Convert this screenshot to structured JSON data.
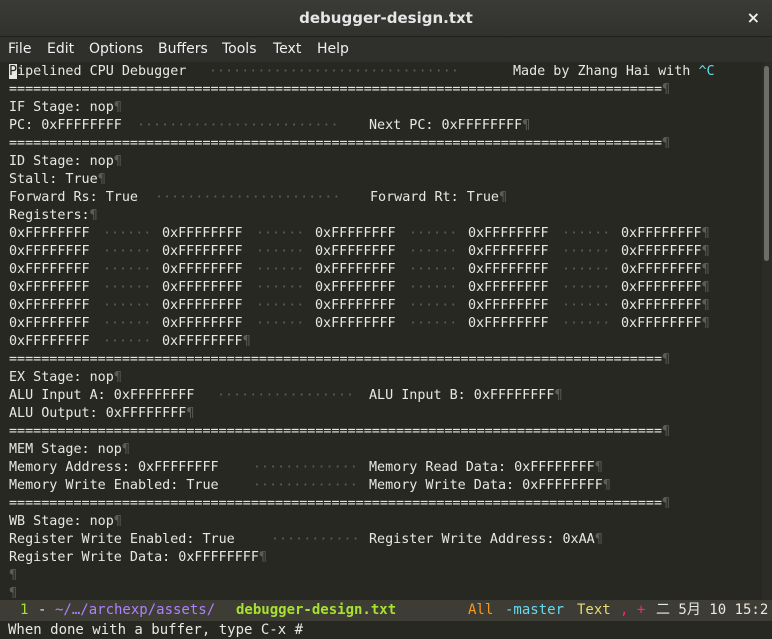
{
  "window": {
    "title": "debugger-design.txt",
    "close_glyph": "×"
  },
  "menu": [
    "File",
    "Edit",
    "Options",
    "Buffers",
    "Tools",
    "Text",
    "Help"
  ],
  "header": {
    "first_char": "P",
    "title_rest": "ipelined CPU Debugger",
    "credit": "Made by Zhang Hai with ",
    "credit_ctrl": "^C"
  },
  "separator": "=================================================================================",
  "if": {
    "stage": "IF Stage: nop",
    "pc": "PC: 0xFFFFFFFF",
    "next_pc": "Next PC: 0xFFFFFFFF"
  },
  "id": {
    "stage": "ID Stage: nop",
    "stall": "Stall: True",
    "forward_rs": "Forward Rs: True",
    "forward_rt": "Forward Rt: True",
    "registers_label": "Registers:",
    "registers": [
      [
        "0xFFFFFFFF",
        "0xFFFFFFFF",
        "0xFFFFFFFF",
        "0xFFFFFFFF",
        "0xFFFFFFFF"
      ],
      [
        "0xFFFFFFFF",
        "0xFFFFFFFF",
        "0xFFFFFFFF",
        "0xFFFFFFFF",
        "0xFFFFFFFF"
      ],
      [
        "0xFFFFFFFF",
        "0xFFFFFFFF",
        "0xFFFFFFFF",
        "0xFFFFFFFF",
        "0xFFFFFFFF"
      ],
      [
        "0xFFFFFFFF",
        "0xFFFFFFFF",
        "0xFFFFFFFF",
        "0xFFFFFFFF",
        "0xFFFFFFFF"
      ],
      [
        "0xFFFFFFFF",
        "0xFFFFFFFF",
        "0xFFFFFFFF",
        "0xFFFFFFFF",
        "0xFFFFFFFF"
      ],
      [
        "0xFFFFFFFF",
        "0xFFFFFFFF",
        "0xFFFFFFFF",
        "0xFFFFFFFF",
        "0xFFFFFFFF"
      ],
      [
        "0xFFFFFFFF",
        "0xFFFFFFFF"
      ]
    ]
  },
  "ex": {
    "stage": "EX Stage: nop",
    "alu_a": "ALU Input A: 0xFFFFFFFF",
    "alu_b": "ALU Input B: 0xFFFFFFFF",
    "alu_out": "ALU Output: 0xFFFFFFFF"
  },
  "mem": {
    "stage": "MEM Stage: nop",
    "address": "Memory Address: 0xFFFFFFFF",
    "read_data": "Memory Read Data: 0xFFFFFFFF",
    "write_enabled": "Memory Write Enabled: True",
    "write_data": "Memory Write Data: 0xFFFFFFFF"
  },
  "wb": {
    "stage": "WB Stage: nop",
    "reg_write_enabled": "Register Write Enabled: True",
    "reg_write_address": "Register Write Address: 0xAA",
    "reg_write_data": "Register Write Data: 0xFFFFFFFF"
  },
  "pilcrow": "¶",
  "modeline": {
    "line_number": "1",
    "dash": "-",
    "path": "~/…/archexp/assets/",
    "filename": "debugger-design.txt",
    "position": "All",
    "branch": "-master",
    "mode": "Text",
    "flags": ", +",
    "datetime": "二 5月 10 15:2"
  },
  "minibuffer": "When done with a buffer, type C-x #",
  "colors": {
    "background": "#272822",
    "whitespace": "#5d5d55",
    "modeline_number": "#a6e22e",
    "modeline_path": "#ae81ff",
    "modeline_filename": "#a6e22e",
    "modeline_position": "#fd971f",
    "modeline_branch": "#66d9ef",
    "modeline_flags": "#f92672"
  }
}
